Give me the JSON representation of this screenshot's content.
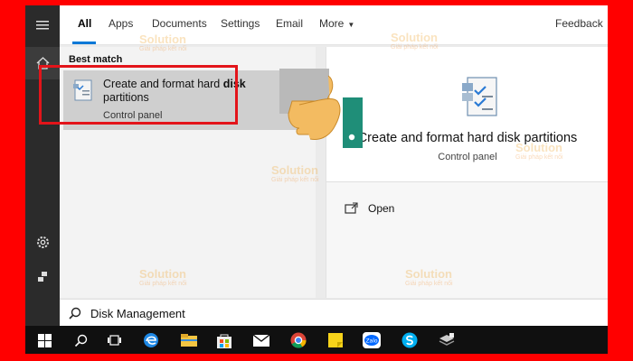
{
  "tabs": [
    {
      "label": "All",
      "selected": true
    },
    {
      "label": "Apps"
    },
    {
      "label": "Documents"
    },
    {
      "label": "Settings"
    },
    {
      "label": "Email"
    },
    {
      "label": "More"
    }
  ],
  "feedback_label": "Feedback",
  "best_match": {
    "heading": "Best match",
    "title_main": "Create and format hard ",
    "title_bold": "disk",
    "title_rest": "partitions",
    "subtitle": "Control panel"
  },
  "preview": {
    "title": "Create and format hard disk partitions",
    "subtitle": "Control panel",
    "actions": [
      {
        "label": "Open",
        "icon": "open-icon"
      }
    ]
  },
  "search": {
    "query": "Disk Management"
  },
  "watermark": {
    "brand": "Solution",
    "tagline": "Giải pháp kết nối"
  },
  "rail_icons": [
    "hamburger-icon",
    "home-icon",
    "gear-icon",
    "user-icon"
  ],
  "taskbar_icons": [
    "windows-icon",
    "search-icon",
    "task-view-icon",
    "edge-icon",
    "file-explorer-icon",
    "store-icon",
    "mail-icon",
    "chrome-icon",
    "sticky-notes-icon",
    "zalo-icon",
    "skype-icon",
    "app-icon"
  ],
  "taskbar_zalo_label": "Zalo",
  "colors": {
    "highlight_border": "#e3141a",
    "background": "#ff0000",
    "accent": "#0078d7"
  }
}
